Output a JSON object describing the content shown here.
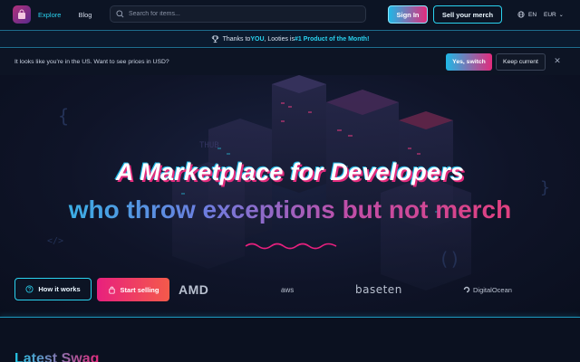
{
  "nav": {
    "logo_icon": "bag-icon",
    "links": [
      {
        "label": "Explore",
        "active": true
      },
      {
        "label": "Blog",
        "active": false
      }
    ],
    "search_placeholder": "Search for items...",
    "signin_label": "Sign In",
    "sell_label": "Sell your merch",
    "language": "EN",
    "currency": "EUR"
  },
  "promo": {
    "text_a": "Thanks to ",
    "highlight_you": "YOU",
    "text_b": ", Looties is ",
    "highlight_rank": "#1 Product of the Month!"
  },
  "currency_banner": {
    "message": "It looks like you're in the US. Want to see prices in USD?",
    "switch_label": "Yes, switch",
    "keep_label": "Keep current",
    "close_glyph": "✕"
  },
  "hero": {
    "headline_line1": "A Marketplace for Developers",
    "headline_line2": "who throw exceptions but not merch",
    "how_label": "How it works",
    "start_label": "Start selling"
  },
  "sponsors": {
    "amd": "AMD",
    "aws": "aws",
    "baseten": "baseten",
    "digitalocean": "DigitalOcean"
  },
  "section": {
    "title": "Latest Swag"
  },
  "colors": {
    "cyan": "#2ad2ef",
    "pink": "#e22b7c",
    "bg": "#0a1020"
  }
}
